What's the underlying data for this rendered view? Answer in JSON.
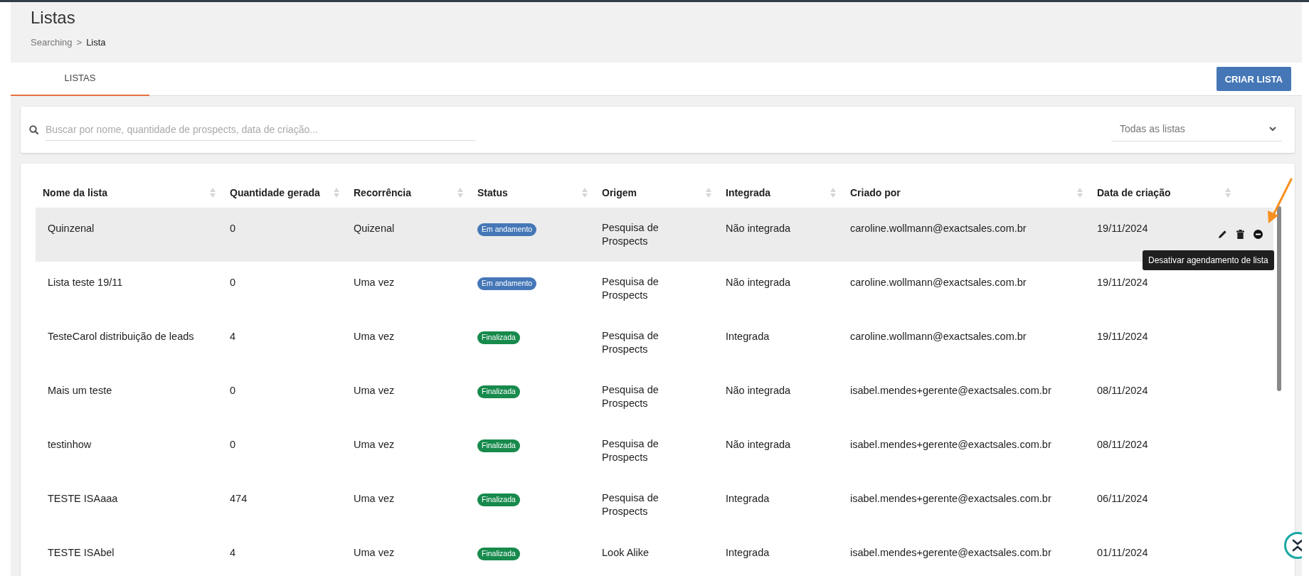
{
  "header": {
    "title": "Listas",
    "breadcrumb": [
      {
        "label": "Searching",
        "current": false
      },
      {
        "label": ">",
        "current": false
      },
      {
        "label": "Lista",
        "current": true
      }
    ]
  },
  "tabs": [
    {
      "label": "LISTAS",
      "selected": true
    }
  ],
  "create_button": "CRIAR LISTA",
  "search": {
    "placeholder": "Buscar por nome, quantidade de prospects, data de criação..."
  },
  "filter": {
    "value": "Todas as listas"
  },
  "table": {
    "columns": [
      "Nome da lista",
      "Quantidade gerada",
      "Recorrência",
      "Status",
      "Origem",
      "Integrada",
      "Criado por",
      "Data de criação"
    ],
    "rows": [
      {
        "name": "Quinzenal",
        "quantity": "0",
        "recurrence": "Quizenal",
        "status": {
          "label": "Em andamento",
          "kind": "running"
        },
        "origin": "Pesquisa de Prospects",
        "integrated": "Não integrada",
        "created_by": "caroline.wollmann@exactsales.com.br",
        "date": "19/11/2024",
        "hovered": true
      },
      {
        "name": "Lista teste 19/11",
        "quantity": "0",
        "recurrence": "Uma vez",
        "status": {
          "label": "Em andamento",
          "kind": "running"
        },
        "origin": "Pesquisa de Prospects",
        "integrated": "Não integrada",
        "created_by": "caroline.wollmann@exactsales.com.br",
        "date": "19/11/2024",
        "hovered": false
      },
      {
        "name": "TesteCarol distribuição de leads",
        "quantity": "4",
        "recurrence": "Uma vez",
        "status": {
          "label": "Finalizada",
          "kind": "done"
        },
        "origin": "Pesquisa de Prospects",
        "integrated": "Integrada",
        "created_by": "caroline.wollmann@exactsales.com.br",
        "date": "19/11/2024",
        "hovered": false
      },
      {
        "name": "Mais um teste",
        "quantity": "0",
        "recurrence": "Uma vez",
        "status": {
          "label": "Finalizada",
          "kind": "done"
        },
        "origin": "Pesquisa de Prospects",
        "integrated": "Não integrada",
        "created_by": "isabel.mendes+gerente@exactsales.com.br",
        "date": "08/11/2024",
        "hovered": false
      },
      {
        "name": "testinhow",
        "quantity": "0",
        "recurrence": "Uma vez",
        "status": {
          "label": "Finalizada",
          "kind": "done"
        },
        "origin": "Pesquisa de Prospects",
        "integrated": "Não integrada",
        "created_by": "isabel.mendes+gerente@exactsales.com.br",
        "date": "08/11/2024",
        "hovered": false
      },
      {
        "name": "TESTE ISAaaa",
        "quantity": "474",
        "recurrence": "Uma vez",
        "status": {
          "label": "Finalizada",
          "kind": "done"
        },
        "origin": "Pesquisa de Prospects",
        "integrated": "Integrada",
        "created_by": "isabel.mendes+gerente@exactsales.com.br",
        "date": "06/11/2024",
        "hovered": false
      },
      {
        "name": "TESTE ISAbel",
        "quantity": "4",
        "recurrence": "Uma vez",
        "status": {
          "label": "Finalizada",
          "kind": "done"
        },
        "origin": "Look Alike",
        "integrated": "Integrada",
        "created_by": "isabel.mendes+gerente@exactsales.com.br",
        "date": "01/11/2024",
        "hovered": false
      }
    ]
  },
  "tooltip": "Desativar agendamento de lista"
}
